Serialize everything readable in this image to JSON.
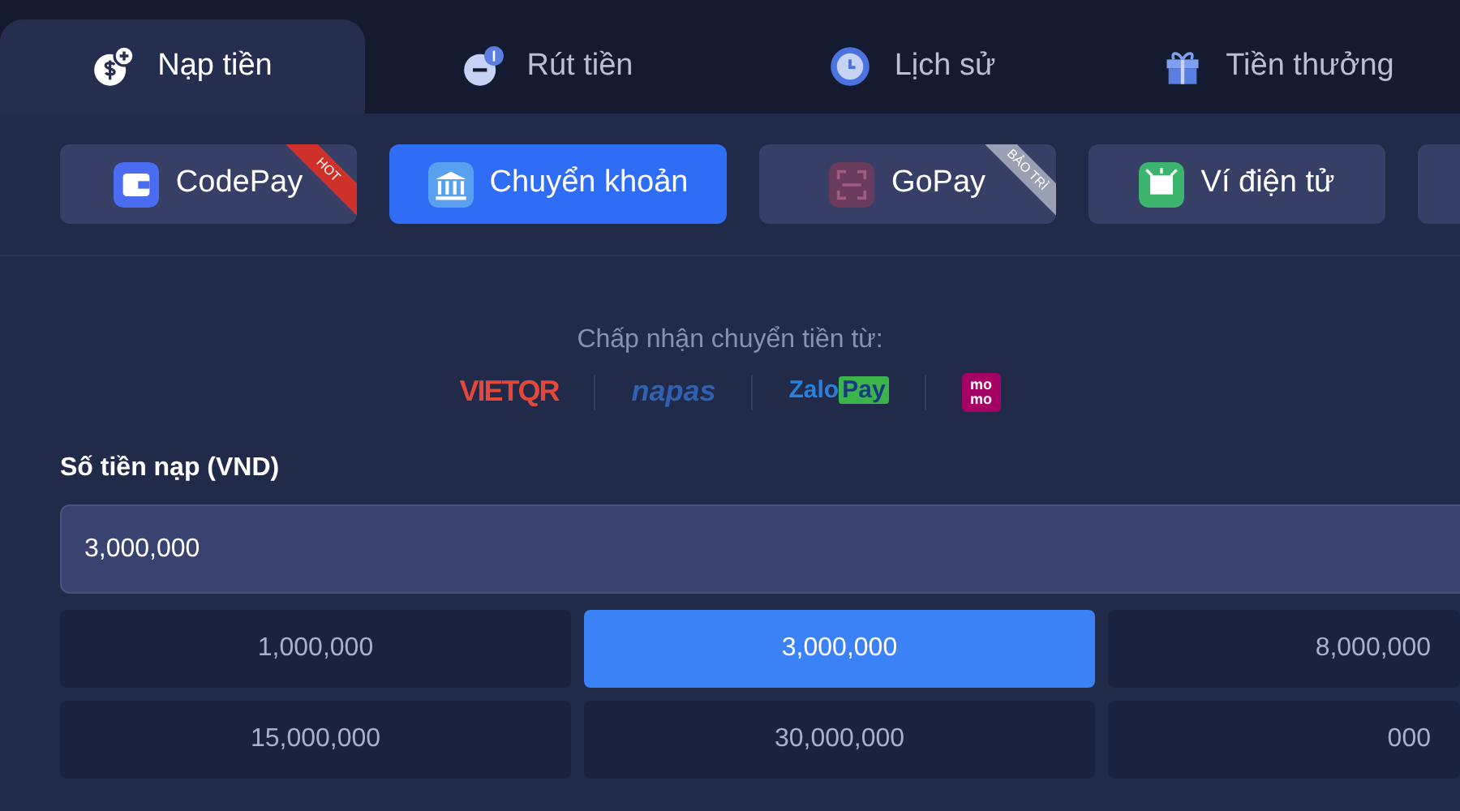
{
  "tabs": [
    {
      "label": "Nạp tiền",
      "selected": true
    },
    {
      "label": "Rút tiền",
      "selected": false
    },
    {
      "label": "Lịch sử",
      "selected": false
    },
    {
      "label": "Tiền thưởng",
      "selected": false
    }
  ],
  "methods": [
    {
      "label": "CodePay",
      "selected": false,
      "ribbon": {
        "text": "HOT",
        "color": "#d0302a"
      }
    },
    {
      "label": "Chuyển khoản",
      "selected": true
    },
    {
      "label": "GoPay",
      "selected": false,
      "ribbon": {
        "text": "BẢO TRÌ",
        "color": "#9aa0b4"
      }
    },
    {
      "label": "Ví điện tử",
      "selected": false
    },
    {
      "selected": false
    }
  ],
  "accepted": {
    "caption": "Chấp nhận chuyển tiền từ:",
    "logos": [
      {
        "kind": "vietqr",
        "text": "VIETQR"
      },
      {
        "kind": "napas",
        "text": "napas"
      },
      {
        "kind": "zalopay",
        "text": "Zalo",
        "text2": "Pay"
      },
      {
        "kind": "momo",
        "text": "mo",
        "text2": "mo"
      }
    ]
  },
  "amount": {
    "label": "Số tiền nạp (VND)",
    "value": "3,000,000"
  },
  "presets": [
    {
      "label": "1,000,000",
      "selected": false
    },
    {
      "label": "3,000,000",
      "selected": true
    },
    {
      "label": "8,000,000",
      "selected": false
    },
    {
      "label": "15,000,000",
      "selected": false
    },
    {
      "label": "30,000,000",
      "selected": false
    },
    {
      "label": "000",
      "selected": false
    }
  ]
}
